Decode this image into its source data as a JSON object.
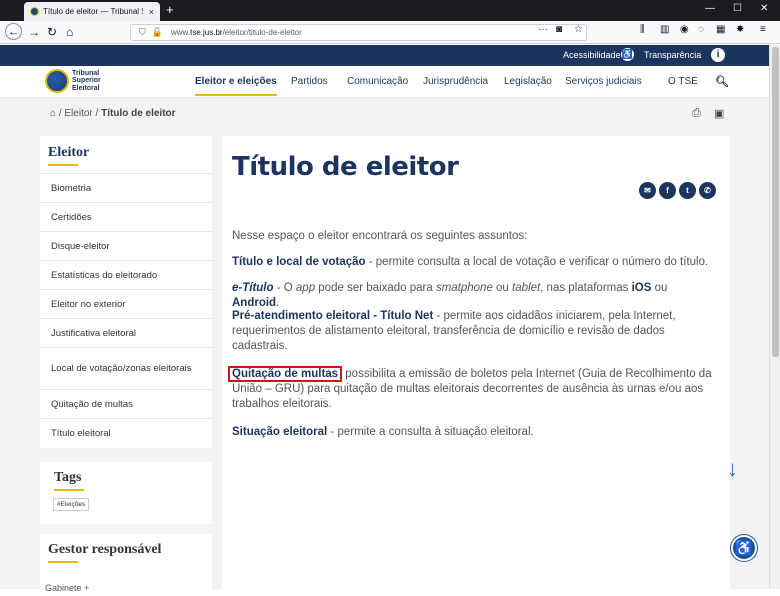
{
  "browser": {
    "tab_title": "Título de eleitor — Tribunal Sup",
    "tab_close": "×",
    "new_tab": "+",
    "url_prefix": "www.",
    "url_host": "tse.jus.br",
    "url_path": "/eleitor/titulo-de-eleitor",
    "more": "···"
  },
  "topstrip": {
    "accessibility": "Acessibilidade",
    "transparency": "Transparência"
  },
  "logo": {
    "line1": "Tribunal",
    "line2": "Superior",
    "line3": "Eleitoral"
  },
  "menu": {
    "items": [
      "Eleitor e eleições",
      "Partidos",
      "Comunicação",
      "Jurisprudência",
      "Legislação",
      "Serviços judiciais",
      "O TSE"
    ]
  },
  "breadcrumb": {
    "sep": "/",
    "level1": "Eleitor",
    "current": "Título de eleitor"
  },
  "sidebar": {
    "title": "Eleitor",
    "items": [
      "Biometria",
      "Certidões",
      "Disque-eleitor",
      "Estatísticas do eleitorado",
      "Eleitor no exterior",
      "Justificativa eleitoral",
      "Local de votação/zonas eleitorais",
      "Quitação de multas",
      "Título eleitoral"
    ]
  },
  "tags": {
    "title": "Tags",
    "items": [
      "#Eleições"
    ]
  },
  "gestor": {
    "title": "Gestor responsável",
    "value": "Gabinete +"
  },
  "content": {
    "title": "Título de eleitor",
    "intro": "Nesse espaço o eleitor encontrará os seguintes assuntos:",
    "p1_bold": "Título e local de votação",
    "p1_text": " - permite consulta a local de votação e verificar o número do título.",
    "p2_em": "e-Título",
    "p2_a": " - O ",
    "p2_app": "app",
    "p2_b": " pode ser baixado para ",
    "p2_smart": "smatphone",
    "p2_c": " ou ",
    "p2_tablet": "tablet",
    "p2_d": ", nas plataformas ",
    "p2_ios": "iOS",
    "p2_e": " ou ",
    "p2_android": "Android",
    "p2_f": ".",
    "p3_bold": "Pré-atendimento eleitoral - Título Net",
    "p3_text": " - permite aos cidadãos iniciarem, pela Internet, requerimentos de alistamento eleitoral, transferência de domicílio e revisão de dados cadastrais.",
    "p4_bold": "Quitação de multas",
    "p4_text": " possibilita a emissão de boletos pela Internet (Guia de Recolhimento da União – GRU) para quitação de multas eleitorais decorrentes de ausência às urnas e/ou aos trabalhos eleitorais.",
    "p5_bold": "Situação eleitoral",
    "p5_text": " - permite a consulta à situação eleitoral."
  },
  "share": [
    "email",
    "facebook",
    "twitter",
    "whatsapp"
  ],
  "colors": {
    "brand": "#1b355e",
    "accent": "#e6b800",
    "highlight": "#d4141c"
  }
}
